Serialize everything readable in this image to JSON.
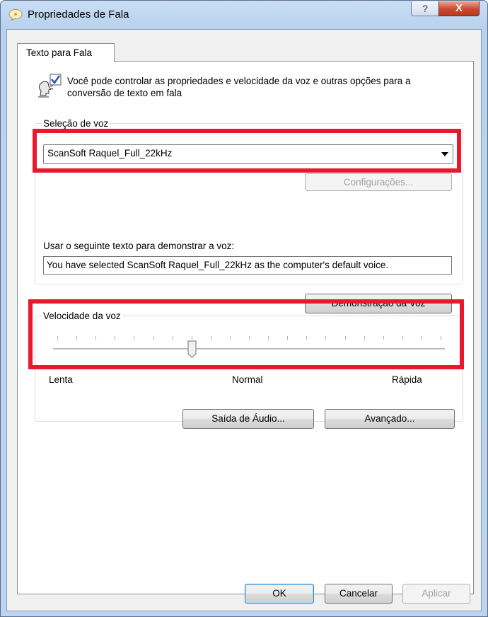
{
  "window": {
    "title": "Propriedades de Fala",
    "help_symbol": "?",
    "close_symbol": "X"
  },
  "tabs": [
    {
      "label": "Texto para Fala",
      "selected": true
    }
  ],
  "intro_text": "Você pode controlar as propriedades e velocidade da voz e outras opções para a conversão de texto em fala",
  "voice_selection": {
    "group_label": "Seleção de voz",
    "selected_voice": "ScanSoft Raquel_Full_22kHz",
    "settings_button": "Configurações...",
    "preview_label": "Usar o seguinte texto para demonstrar a voz:",
    "preview_text": "You have selected ScanSoft Raquel_Full_22kHz as the computer's default voice.",
    "preview_button": "Demonstração da Voz"
  },
  "voice_speed": {
    "group_label": "Velocidade da voz",
    "ticks": 21,
    "value_tick": 7,
    "min_label": "Lenta",
    "mid_label": "Normal",
    "max_label": "Rápida"
  },
  "buttons": {
    "audio_output": "Saída de Áudio...",
    "advanced": "Avançado...",
    "ok": "OK",
    "cancel": "Cancelar",
    "apply": "Aplicar"
  },
  "highlight_color": "#e8192c"
}
